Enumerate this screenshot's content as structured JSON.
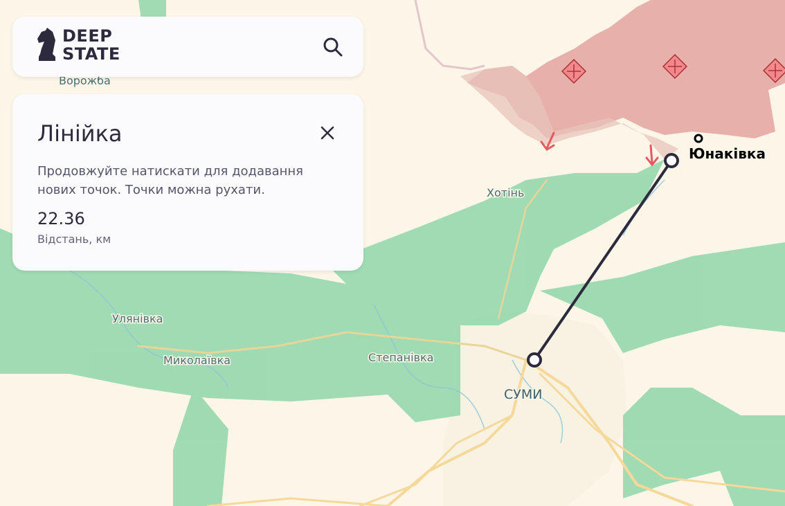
{
  "brand": {
    "line1": "DEEP",
    "line2": "STATE"
  },
  "ruler": {
    "title": "Лінійка",
    "hint": "Продовжуйте натискати для додавання нових точок. Точки можна рухати.",
    "distance": "22.36",
    "distance_label": "Відстань, км"
  },
  "places": {
    "vorozhba": "Ворожба",
    "khotin": "Хотінь",
    "ulianivka": "Улянівка",
    "mykolaivka": "Миколаївка",
    "stepanivka": "Степанівка",
    "sumy": "СУМИ",
    "yunakivka": "Юнаківка"
  },
  "colors": {
    "land": "#fbf6e8",
    "forest": "#7fcfa0",
    "occupied": "#e6a8a4",
    "ruler_line": "#2d2a3e",
    "road": "#f6d89a"
  },
  "icons": [
    "chess-knight-logo-icon",
    "search-icon",
    "close-icon",
    "battle-marker-icon",
    "attack-arrow-icon"
  ]
}
